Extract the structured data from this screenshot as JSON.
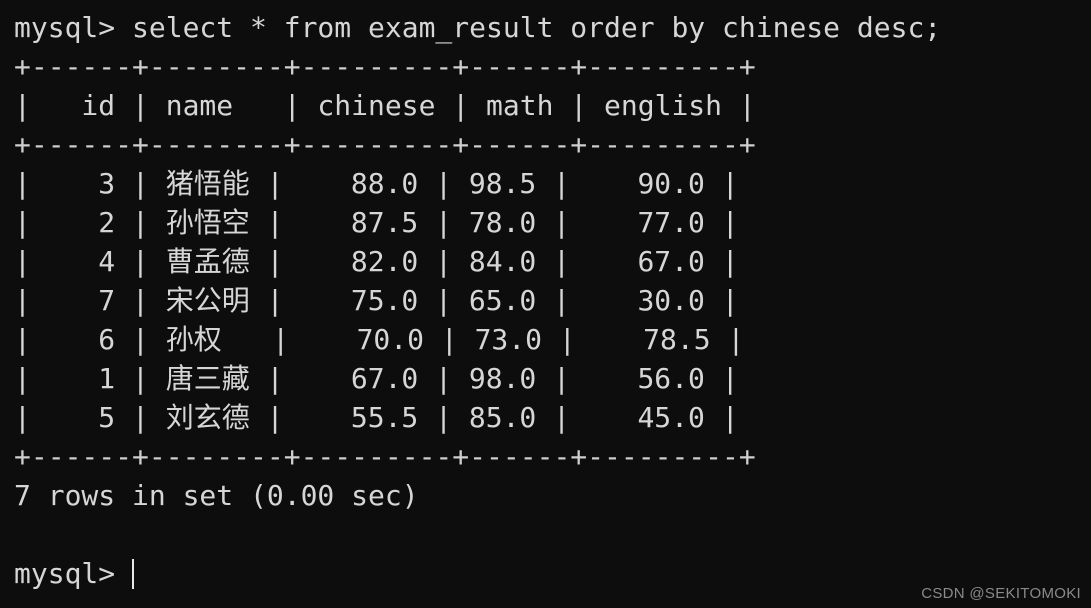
{
  "terminal": {
    "prompt": "mysql>",
    "query": " select * from exam_result order by chinese desc;",
    "query_line": "mysql> select * from exam_result order by chinese desc;",
    "border": "+------+--------+---------+------+---------+",
    "header_row": "|   id | name   | chinese | math | english |",
    "header_labels": [
      "id",
      "name",
      "chinese",
      "math",
      "english"
    ],
    "status": "7 rows in set (0.00 sec)",
    "blank": " ",
    "final_prompt": "mysql>",
    "rows_text": [
      "|    3 | 猪悟能 |    88.0 | 98.5 |    90.0 |",
      "|    2 | 孙悟空 |    87.5 | 78.0 |    77.0 |",
      "|    4 | 曹孟德 |    82.0 | 84.0 |    67.0 |",
      "|    7 | 宋公明 |    75.0 | 65.0 |    30.0 |",
      "|    6 | 孙权   |    70.0 | 73.0 |    78.5 |",
      "|    1 | 唐三藏 |    67.0 | 98.0 |    56.0 |",
      "|    5 | 刘玄德 |    55.5 | 85.0 |    45.0 |"
    ],
    "rows": [
      {
        "id": "3",
        "name": "猪悟能",
        "chinese": "88.0",
        "math": "98.5",
        "english": "90.0"
      },
      {
        "id": "2",
        "name": "孙悟空",
        "chinese": "87.5",
        "math": "78.0",
        "english": "77.0"
      },
      {
        "id": "4",
        "name": "曹孟德",
        "chinese": "82.0",
        "math": "84.0",
        "english": "67.0"
      },
      {
        "id": "7",
        "name": "宋公明",
        "chinese": "75.0",
        "math": "65.0",
        "english": "30.0"
      },
      {
        "id": "6",
        "name": "孙权",
        "chinese": "70.0",
        "math": "73.0",
        "english": "78.5"
      },
      {
        "id": "1",
        "name": "唐三藏",
        "chinese": "67.0",
        "math": "98.0",
        "english": "56.0"
      },
      {
        "id": "5",
        "name": "刘玄德",
        "chinese": "55.5",
        "math": "85.0",
        "english": "45.0"
      }
    ],
    "row_count": "7",
    "elapsed": "0.00 sec",
    "table_name": "exam_result",
    "colors": {
      "background": "#0d0d0d",
      "foreground": "#d6d6d6",
      "cursor": "#e8e8e8",
      "watermark": "#8a8a8a"
    }
  },
  "watermark": {
    "text": "CSDN @SEKITOMOKI"
  }
}
